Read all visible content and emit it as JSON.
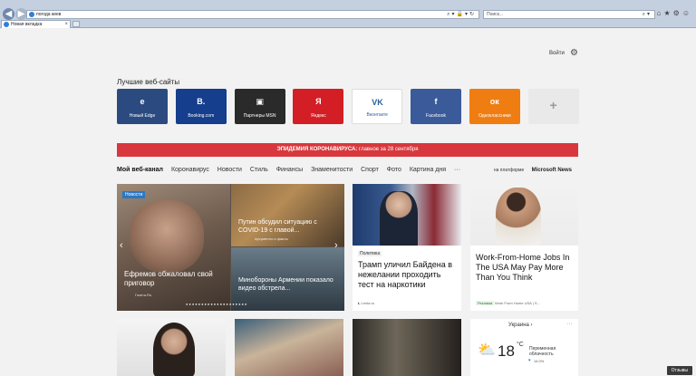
{
  "chrome": {
    "address": "погода киев",
    "search_placeholder": "Поиск...",
    "tab_title": "Новая вкладка"
  },
  "page": {
    "signin": "Войти",
    "top_sites_title": "Лучшие веб-сайты",
    "tiles": [
      {
        "label": "Новый Edge",
        "color": "#2b4a80",
        "icon": "edge-logo",
        "glyph": "e"
      },
      {
        "label": "Booking.com",
        "color": "#153e8c",
        "icon": "booking-logo",
        "glyph": "B."
      },
      {
        "label": "Партнеры MSN",
        "color": "#2a2a2a",
        "icon": "msn-logo",
        "glyph": "▣"
      },
      {
        "label": "Яндекс",
        "color": "#d31e25",
        "icon": "yandex-logo",
        "glyph": "Я"
      },
      {
        "label": "Вконтакте",
        "color": "#ffffff",
        "icon": "vk-logo",
        "glyph": "VK"
      },
      {
        "label": "Facebook",
        "color": "#3b5a9a",
        "icon": "facebook-logo",
        "glyph": "f"
      },
      {
        "label": "Одноклассники",
        "color": "#ef7d12",
        "icon": "ok-logo",
        "glyph": "ок"
      },
      {
        "label": "",
        "color": "#e9e9e9",
        "icon": "add-icon",
        "glyph": "+"
      }
    ],
    "banner": {
      "bold": "ЭПИДЕМИЯ КОРОНАВИРУСА:",
      "rest": " главное за 28 сентября"
    },
    "nav": [
      "Мой веб-канал",
      "Коронавирус",
      "Новости",
      "Стиль",
      "Финансы",
      "Знаменитости",
      "Спорт",
      "Фото",
      "Картина дня",
      "···"
    ],
    "platform_prefix": "на платформе",
    "platform_brand": "Microsoft News",
    "hero": {
      "badge": "Новости",
      "main_title": "Ефремов обжаловал свой приговор",
      "main_source": "Газета.Ru",
      "tr_title": "Путин обсудил ситуацию с COVID-19 с главой...",
      "tr_source": "Аргументы и факты",
      "br_title": "Минобороны Армении показало видео обстрела..."
    },
    "cards": {
      "biden": {
        "category": "Политика",
        "title": "Трамп уличил Байдена в нежелании проходить тест на наркотики",
        "source": "Lenta.ru"
      },
      "ad": {
        "title": "Work-From-Home Jobs In The USA May Pay More Than You Think",
        "ad_label": "Реклама",
        "source": "Work From Home USA | S..."
      }
    },
    "weather": {
      "location": "Украина",
      "temp": "18",
      "unit": "°C",
      "condition": "Переменная облачность",
      "low": "14.0%"
    },
    "feedback": "Отзывы"
  },
  "colors": {
    "banner": "#d8383d",
    "accent": "#2b78c5"
  }
}
